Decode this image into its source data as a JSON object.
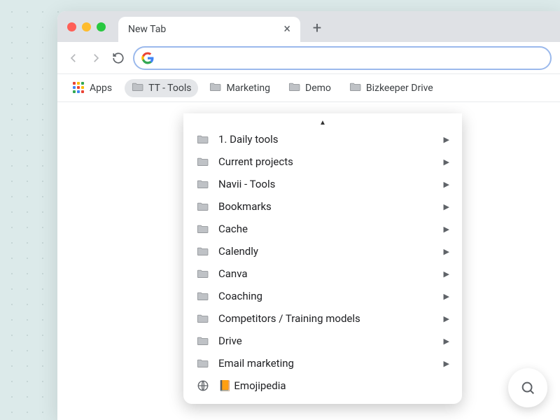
{
  "tab": {
    "title": "New Tab"
  },
  "omnibox": {
    "value": "",
    "placeholder": ""
  },
  "bookmarks_bar": {
    "apps_label": "Apps",
    "items": [
      {
        "label": "TT - Tools",
        "active": true
      },
      {
        "label": "Marketing",
        "active": false
      },
      {
        "label": "Demo",
        "active": false
      },
      {
        "label": "Bizkeeper Drive",
        "active": false
      }
    ]
  },
  "dropdown": {
    "items": [
      {
        "label": "1. Daily tools",
        "type": "folder"
      },
      {
        "label": "Current projects",
        "type": "folder"
      },
      {
        "label": "Navii - Tools",
        "type": "folder"
      },
      {
        "label": "Bookmarks",
        "type": "folder"
      },
      {
        "label": "Cache",
        "type": "folder"
      },
      {
        "label": "Calendly",
        "type": "folder"
      },
      {
        "label": "Canva",
        "type": "folder"
      },
      {
        "label": "Coaching",
        "type": "folder"
      },
      {
        "label": "Competitors / Training models",
        "type": "folder"
      },
      {
        "label": "Drive",
        "type": "folder"
      },
      {
        "label": "Email marketing",
        "type": "folder"
      },
      {
        "label": "📙 Emojipedia",
        "type": "link"
      }
    ]
  }
}
